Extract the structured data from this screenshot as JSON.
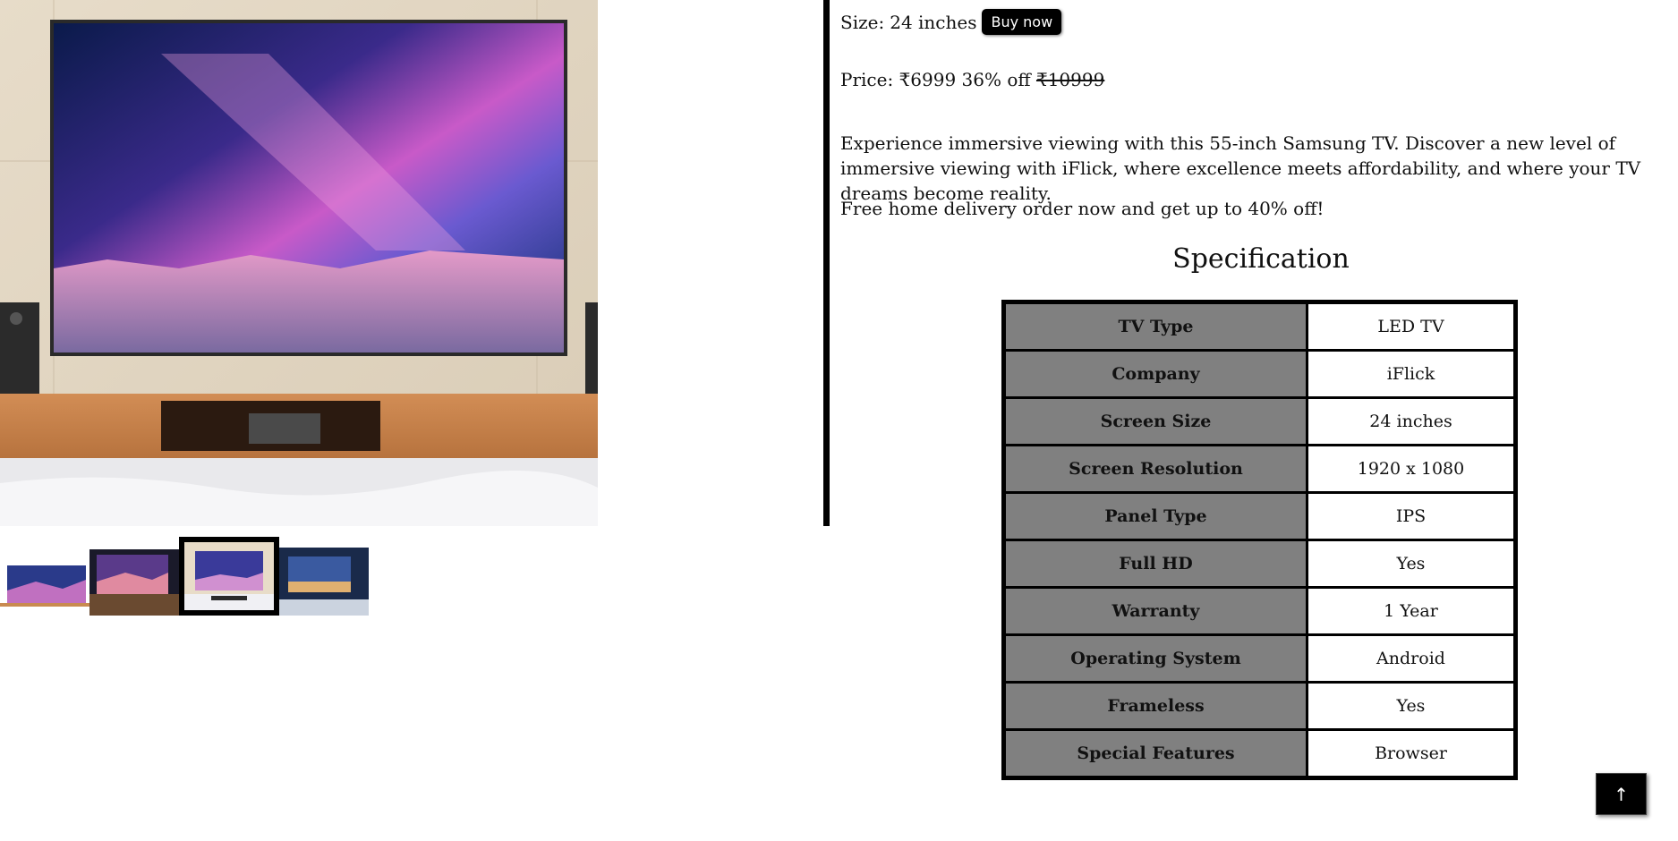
{
  "product": {
    "main_image_alt": "55-inch TV wall mount",
    "size_label": "Size:",
    "size_value": "24 inches",
    "buy_label": "Buy now",
    "price_label": "Price:",
    "price_current": "₹6999",
    "discount": "36% off",
    "price_original": "₹10999",
    "description": "Experience immersive viewing with this 55-inch Samsung TV. Discover a new level of immersive viewing with iFlick, where excellence meets affordability, and where your TV dreams become reality.",
    "promo": "Free home delivery order now and get up to 40% off!"
  },
  "thumbnails": [
    {
      "alt": "thumbnail 1",
      "active": false
    },
    {
      "alt": "thumbnail 2",
      "active": false
    },
    {
      "alt": "thumbnail 3",
      "active": true
    },
    {
      "alt": "thumbnail 4",
      "active": false
    }
  ],
  "specification": {
    "title": "Specification",
    "rows": [
      {
        "key": "TV Type",
        "value": "LED TV"
      },
      {
        "key": "Company",
        "value": "iFlick"
      },
      {
        "key": "Screen Size",
        "value": "24 inches"
      },
      {
        "key": "Screen Resolution",
        "value": "1920 x 1080"
      },
      {
        "key": "Panel Type",
        "value": "IPS"
      },
      {
        "key": "Full HD",
        "value": "Yes"
      },
      {
        "key": "Warranty",
        "value": "1 Year"
      },
      {
        "key": "Operating System",
        "value": "Android"
      },
      {
        "key": "Frameless",
        "value": "Yes"
      },
      {
        "key": "Special Features",
        "value": "Browser"
      }
    ]
  },
  "scroll_top": {
    "label": "↑",
    "icon": "arrow-up-icon"
  },
  "colors": {
    "table_key_bg": "#808080",
    "button_bg": "#000000"
  }
}
